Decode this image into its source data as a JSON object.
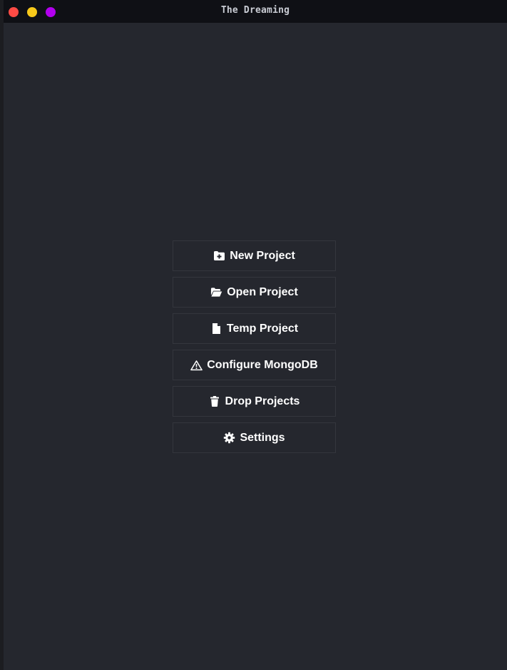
{
  "window": {
    "title": "The Dreaming"
  },
  "menu": {
    "items": [
      {
        "label": "New Project",
        "icon": "folder-plus-icon"
      },
      {
        "label": "Open Project",
        "icon": "folder-open-icon"
      },
      {
        "label": "Temp Project",
        "icon": "file-icon"
      },
      {
        "label": "Configure MongoDB",
        "icon": "warning-icon"
      },
      {
        "label": "Drop Projects",
        "icon": "trash-icon"
      },
      {
        "label": "Settings",
        "icon": "gear-icon"
      }
    ]
  },
  "colors": {
    "background": "#25272e",
    "titlebar": "#0f1015",
    "close": "#ff4b45",
    "minimize": "#f7c91a",
    "maximize": "#b200ee",
    "button_border": "#34363d",
    "text": "#ffffff"
  }
}
